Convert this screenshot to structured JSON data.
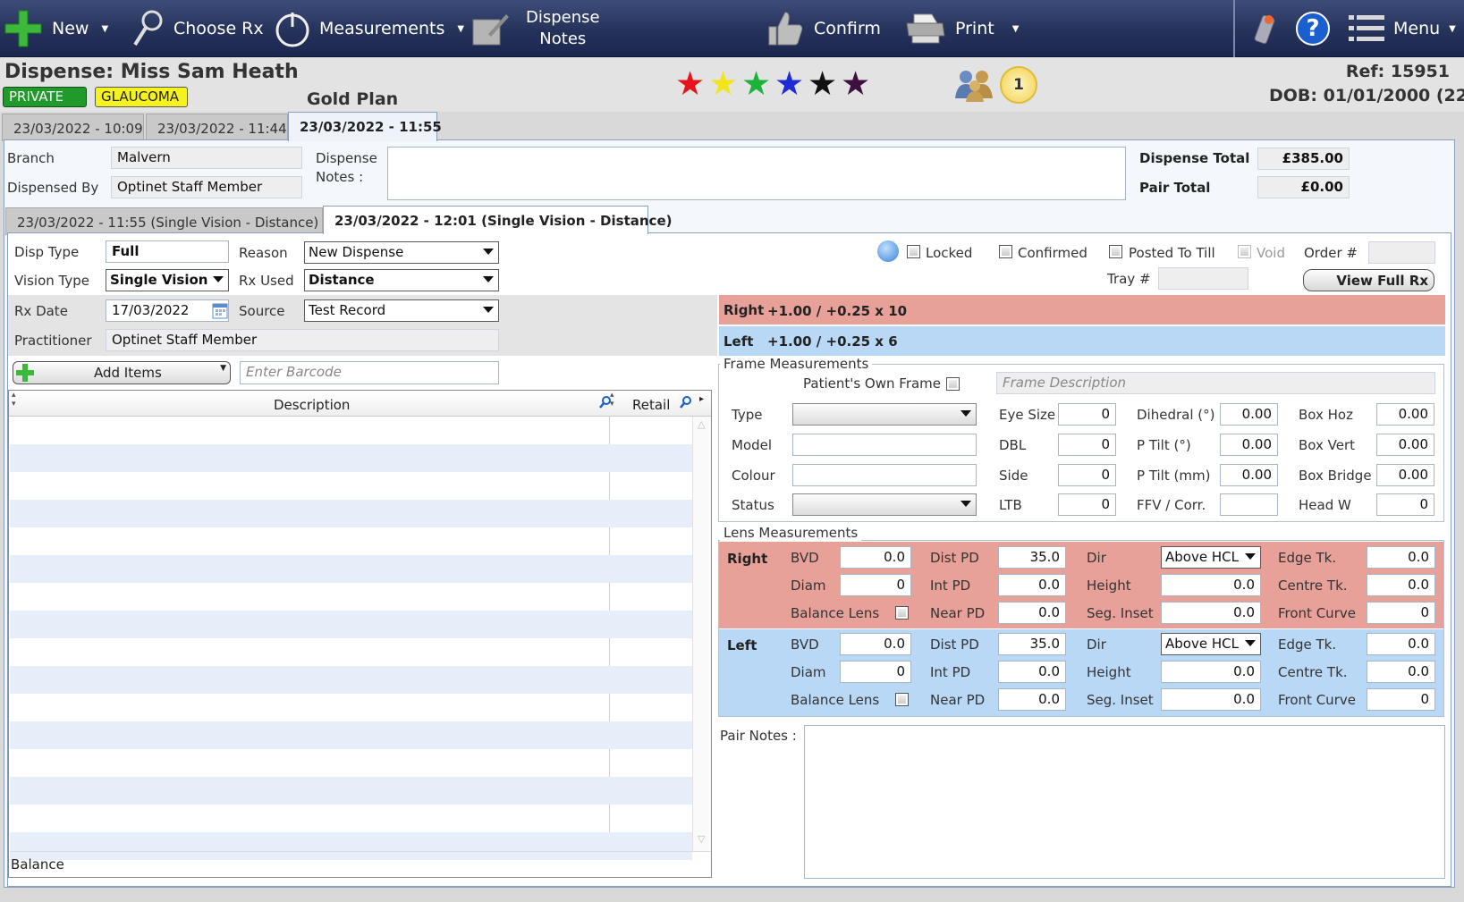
{
  "toolbar": {
    "new_label": "New",
    "choose_rx_label": "Choose Rx",
    "measurements_label": "Measurements",
    "dispense_notes_label_1": "Dispense",
    "dispense_notes_label_2": "Notes",
    "confirm_label": "Confirm",
    "print_label": "Print",
    "menu_label": "Menu",
    "help_glyph": "?"
  },
  "header": {
    "title": "Dispense: Miss Sam Heath",
    "badges": [
      "PRIVATE",
      "GLAUCOMA"
    ],
    "plan": "Gold Plan",
    "ratings_colors": [
      "#e8141b",
      "#f2e51a",
      "#1db33b",
      "#1f2bd6",
      "#111111",
      "#3d1040"
    ],
    "count": "1",
    "ref": "Ref: 15951",
    "dob": "DOB: 01/01/2000 (22"
  },
  "dispense_tabs": [
    "23/03/2022 - 10:09",
    "23/03/2022 - 11:44",
    "23/03/2022 - 11:55"
  ],
  "summary": {
    "branch_label": "Branch",
    "branch_value": "Malvern",
    "dispensed_by_label": "Dispensed By",
    "dispensed_by_value": "Optinet Staff Member",
    "notes_label_1": "Dispense",
    "notes_label_2": "Notes :",
    "notes_value": "",
    "dispense_total_label": "Dispense Total",
    "dispense_total_value": "£385.00",
    "pair_total_label": "Pair Total",
    "pair_total_value": "£0.00"
  },
  "pair_tabs": [
    "23/03/2022 - 11:55 (Single Vision - Distance)",
    "23/03/2022 - 12:01 (Single Vision - Distance)"
  ],
  "form": {
    "disp_type_label": "Disp Type",
    "disp_type_value": "Full",
    "reason_label": "Reason",
    "reason_value": "New Dispense",
    "vision_type_label": "Vision Type",
    "vision_type_value": "Single Vision",
    "rx_used_label": "Rx Used",
    "rx_used_value": "Distance",
    "rx_date_label": "Rx Date",
    "rx_date_value": "17/03/2022",
    "source_label": "Source",
    "source_value": "Test Record",
    "practitioner_label": "Practitioner",
    "practitioner_value": "Optinet Staff Member"
  },
  "status": {
    "locked_label": "Locked",
    "confirmed_label": "Confirmed",
    "posted_label": "Posted To Till",
    "void_label": "Void",
    "order_label": "Order #",
    "order_value": "",
    "tray_label": "Tray #",
    "tray_value": "",
    "view_rx_label": "View Full Rx"
  },
  "rx": {
    "right_label": "Right",
    "right_value": "+1.00 / +0.25 x 10",
    "left_label": "Left",
    "left_value": "+1.00 / +0.25 x 6"
  },
  "items": {
    "add_items_label": "Add Items",
    "barcode_placeholder": "Enter Barcode",
    "col_description": "Description",
    "col_retail": "Retail",
    "balance_label": "Balance"
  },
  "frame": {
    "title": "Frame Measurements",
    "own_frame_label": "Patient's Own Frame",
    "description_placeholder": "Frame Description",
    "type_label": "Type",
    "model_label": "Model",
    "colour_label": "Colour",
    "status_label": "Status",
    "eye_size_label": "Eye Size",
    "eye_size": "0",
    "dbl_label": "DBL",
    "dbl": "0",
    "side_label": "Side",
    "side": "0",
    "ltb_label": "LTB",
    "ltb": "0",
    "dihedral_label": "Dihedral (°)",
    "dihedral": "0.00",
    "ptilt_deg_label": "P Tilt (°)",
    "ptilt_deg": "0.00",
    "ptilt_mm_label": "P Tilt (mm)",
    "ptilt_mm": "0.00",
    "ffv_label": "FFV / Corr.",
    "ffv": "",
    "box_hoz_label": "Box Hoz",
    "box_hoz": "0.00",
    "box_vert_label": "Box Vert",
    "box_vert": "0.00",
    "box_bridge_label": "Box Bridge",
    "box_bridge": "0.00",
    "head_w_label": "Head W",
    "head_w": "0"
  },
  "lens": {
    "title": "Lens Measurements",
    "labels": {
      "bvd": "BVD",
      "diam": "Diam",
      "balance": "Balance Lens",
      "dist_pd": "Dist PD",
      "int_pd": "Int PD",
      "near_pd": "Near PD",
      "dir": "Dir",
      "height": "Height",
      "seg_inset": "Seg. Inset",
      "edge": "Edge Tk.",
      "centre": "Centre Tk.",
      "front_curve": "Front Curve"
    },
    "right": {
      "label": "Right",
      "bvd": "0.0",
      "diam": "0",
      "dist_pd": "35.0",
      "int_pd": "0.0",
      "near_pd": "0.0",
      "dir": "Above HCL",
      "height": "0.0",
      "seg_inset": "0.0",
      "edge": "0.0",
      "centre": "0.0",
      "front_curve": "0"
    },
    "left": {
      "label": "Left",
      "bvd": "0.0",
      "diam": "0",
      "dist_pd": "35.0",
      "int_pd": "0.0",
      "near_pd": "0.0",
      "dir": "Above HCL",
      "height": "0.0",
      "seg_inset": "0.0",
      "edge": "0.0",
      "centre": "0.0",
      "front_curve": "0"
    }
  },
  "pair_notes": {
    "label": "Pair Notes :",
    "value": ""
  },
  "colors": {
    "right_band": "#e8a198",
    "left_band": "#b9d8f5",
    "toolbar": "#25325a"
  }
}
